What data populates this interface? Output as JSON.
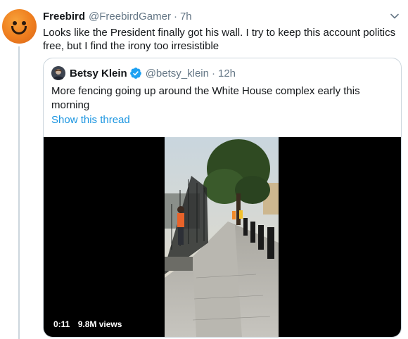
{
  "tweet": {
    "name": "Freebird",
    "handle": "@FreebirdGamer",
    "separator": "·",
    "time": "7h",
    "text": "Looks like the President finally got his wall. I try to keep this account politics free, but I find the irony too irresistible"
  },
  "quoted_tweet": {
    "name": "Betsy Klein",
    "verified": true,
    "handle": "@betsy_klein",
    "separator": "·",
    "time": "12h",
    "text": "More fencing going up around the White House complex early this morning",
    "show_thread_label": "Show this thread",
    "media": {
      "type": "video",
      "duration": "0:11",
      "views": "9.8M views"
    }
  },
  "colors": {
    "link": "#1b95e0",
    "verified": "#1da1f2",
    "muted_text": "#657786",
    "border": "#ccd6dd",
    "avatar_orange": "#ee7d1e"
  },
  "icons": {
    "menu": "chevron-down-icon",
    "verified": "verified-badge-icon"
  }
}
